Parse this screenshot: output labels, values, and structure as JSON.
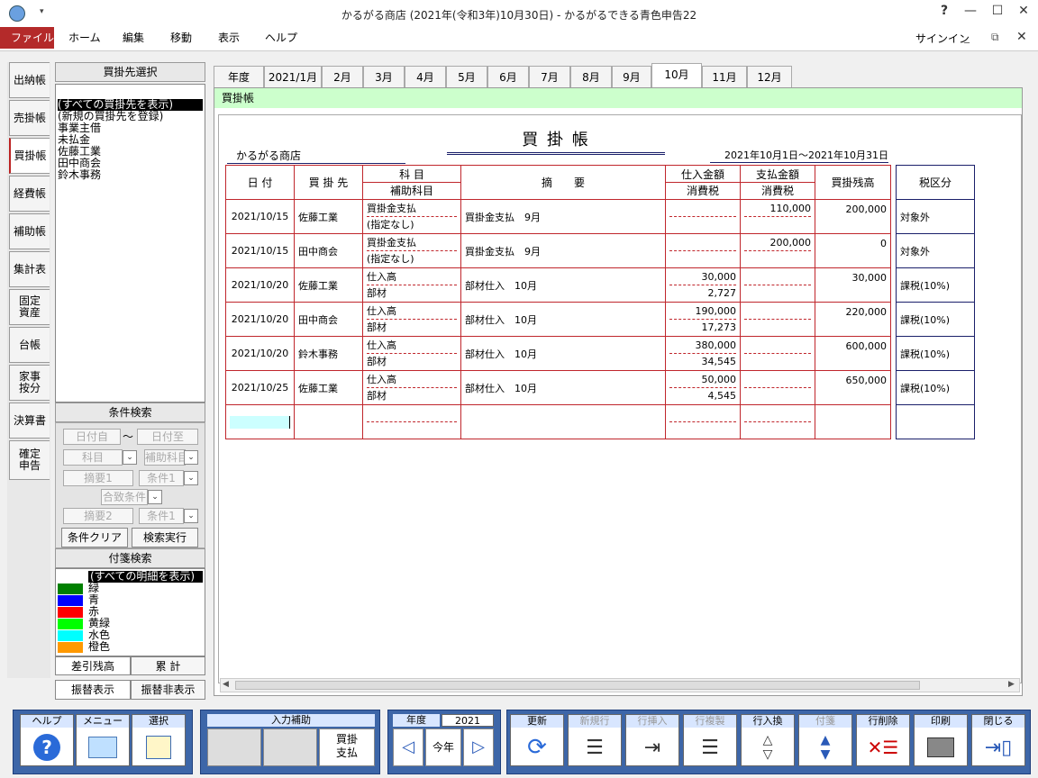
{
  "window": {
    "title": "かるがる商店 (2021年(令和3年)10月30日) - かるがるできる青色申告22",
    "help": "?",
    "signin": "サインイン"
  },
  "menu": {
    "file": "ファイル",
    "items": [
      "ホーム",
      "編集",
      "移動",
      "表示",
      "ヘルプ"
    ]
  },
  "sidetabs": [
    "出納帳",
    "売掛帳",
    "買掛帳",
    "経費帳",
    "補助帳",
    "集計表",
    "固定\n資産",
    "台帳",
    "家事\n按分",
    "決算書",
    "確定\n申告"
  ],
  "vendor_panel": {
    "header": "買掛先選択",
    "items": [
      "(すべての買掛先を表示)",
      "(新規の買掛先を登録)",
      "事業主借",
      "未払金",
      "佐藤工業",
      "田中商会",
      "鈴木事務"
    ]
  },
  "filter_panel": {
    "header": "条件検索",
    "date_from": "日付自",
    "tilde": "〜",
    "date_to": "日付至",
    "account": "科目",
    "sub_account": "補助科目",
    "memo1": "摘要1",
    "cond1": "条件1",
    "match": "合致条件",
    "memo2": "摘要2",
    "cond2": "条件1",
    "clear": "条件クリア",
    "search": "検索実行"
  },
  "tag_panel": {
    "header": "付箋検索",
    "all": "(すべての明細を表示)",
    "tags": [
      {
        "name": "緑",
        "color": "#008000"
      },
      {
        "name": "青",
        "color": "#0000ff"
      },
      {
        "name": "赤",
        "color": "#ff0000"
      },
      {
        "name": "黄緑",
        "color": "#00ff00"
      },
      {
        "name": "水色",
        "color": "#00ffff"
      },
      {
        "name": "橙色",
        "color": "#ff9900"
      }
    ]
  },
  "bottom_tabs": {
    "balance": "差引残高",
    "total": "累 計",
    "transfer_show": "振替表示",
    "transfer_hide": "振替非表示"
  },
  "month_tabs": [
    "年度",
    "2021/1月",
    "2月",
    "3月",
    "4月",
    "5月",
    "6月",
    "7月",
    "8月",
    "9月",
    "10月",
    "11月",
    "12月"
  ],
  "active_month": "10月",
  "section_label": "買掛帳",
  "ledger": {
    "title": "買 掛 帳",
    "company": "かるがる商店",
    "period": "2021年10月1日～2021年10月31日",
    "headers": {
      "date": "日 付",
      "vendor": "買 掛 先",
      "account": "科 目",
      "sub_account": "補助科目",
      "memo": "摘　　要",
      "purchase": "仕入金額",
      "purchase_tax": "消費税",
      "payment": "支払金額",
      "payment_tax": "消費税",
      "balance": "買掛残高",
      "tax_class": "税区分"
    },
    "rows": [
      {
        "date": "2021/10/15",
        "vendor": "佐藤工業",
        "account": "買掛金支払",
        "sub": "(指定なし)",
        "memo": "買掛金支払　9月",
        "purchase": "",
        "ptax": "",
        "payment": "110,000",
        "paytax": "",
        "balance": "200,000",
        "tax": "対象外"
      },
      {
        "date": "2021/10/15",
        "vendor": "田中商会",
        "account": "買掛金支払",
        "sub": "(指定なし)",
        "memo": "買掛金支払　9月",
        "purchase": "",
        "ptax": "",
        "payment": "200,000",
        "paytax": "",
        "balance": "0",
        "tax": "対象外"
      },
      {
        "date": "2021/10/20",
        "vendor": "佐藤工業",
        "account": "仕入高",
        "sub": "部材",
        "memo": "部材仕入　10月",
        "purchase": "30,000",
        "ptax": "2,727",
        "payment": "",
        "paytax": "",
        "balance": "30,000",
        "tax": "課税(10%)"
      },
      {
        "date": "2021/10/20",
        "vendor": "田中商会",
        "account": "仕入高",
        "sub": "部材",
        "memo": "部材仕入　10月",
        "purchase": "190,000",
        "ptax": "17,273",
        "payment": "",
        "paytax": "",
        "balance": "220,000",
        "tax": "課税(10%)"
      },
      {
        "date": "2021/10/20",
        "vendor": "鈴木事務",
        "account": "仕入高",
        "sub": "部材",
        "memo": "部材仕入　10月",
        "purchase": "380,000",
        "ptax": "34,545",
        "payment": "",
        "paytax": "",
        "balance": "600,000",
        "tax": "課税(10%)"
      },
      {
        "date": "2021/10/25",
        "vendor": "佐藤工業",
        "account": "仕入高",
        "sub": "部材",
        "memo": "部材仕入　10月",
        "purchase": "50,000",
        "ptax": "4,545",
        "payment": "",
        "paytax": "",
        "balance": "650,000",
        "tax": "課税(10%)"
      }
    ]
  },
  "toolbar": {
    "help": "ヘルプ",
    "menu": "メニュー",
    "select": "選択",
    "input_assist": "入力補助",
    "kaikake_shiharai": "買掛\n支払",
    "year_label": "年度",
    "year_value": "2021",
    "this_year": "今年",
    "update": "更新",
    "new_row": "新規行",
    "insert_row": "行挿入",
    "copy_row": "行複製",
    "swap_row": "行入換",
    "tag": "付箋",
    "delete_row": "行削除",
    "print": "印刷",
    "close": "閉じる"
  }
}
